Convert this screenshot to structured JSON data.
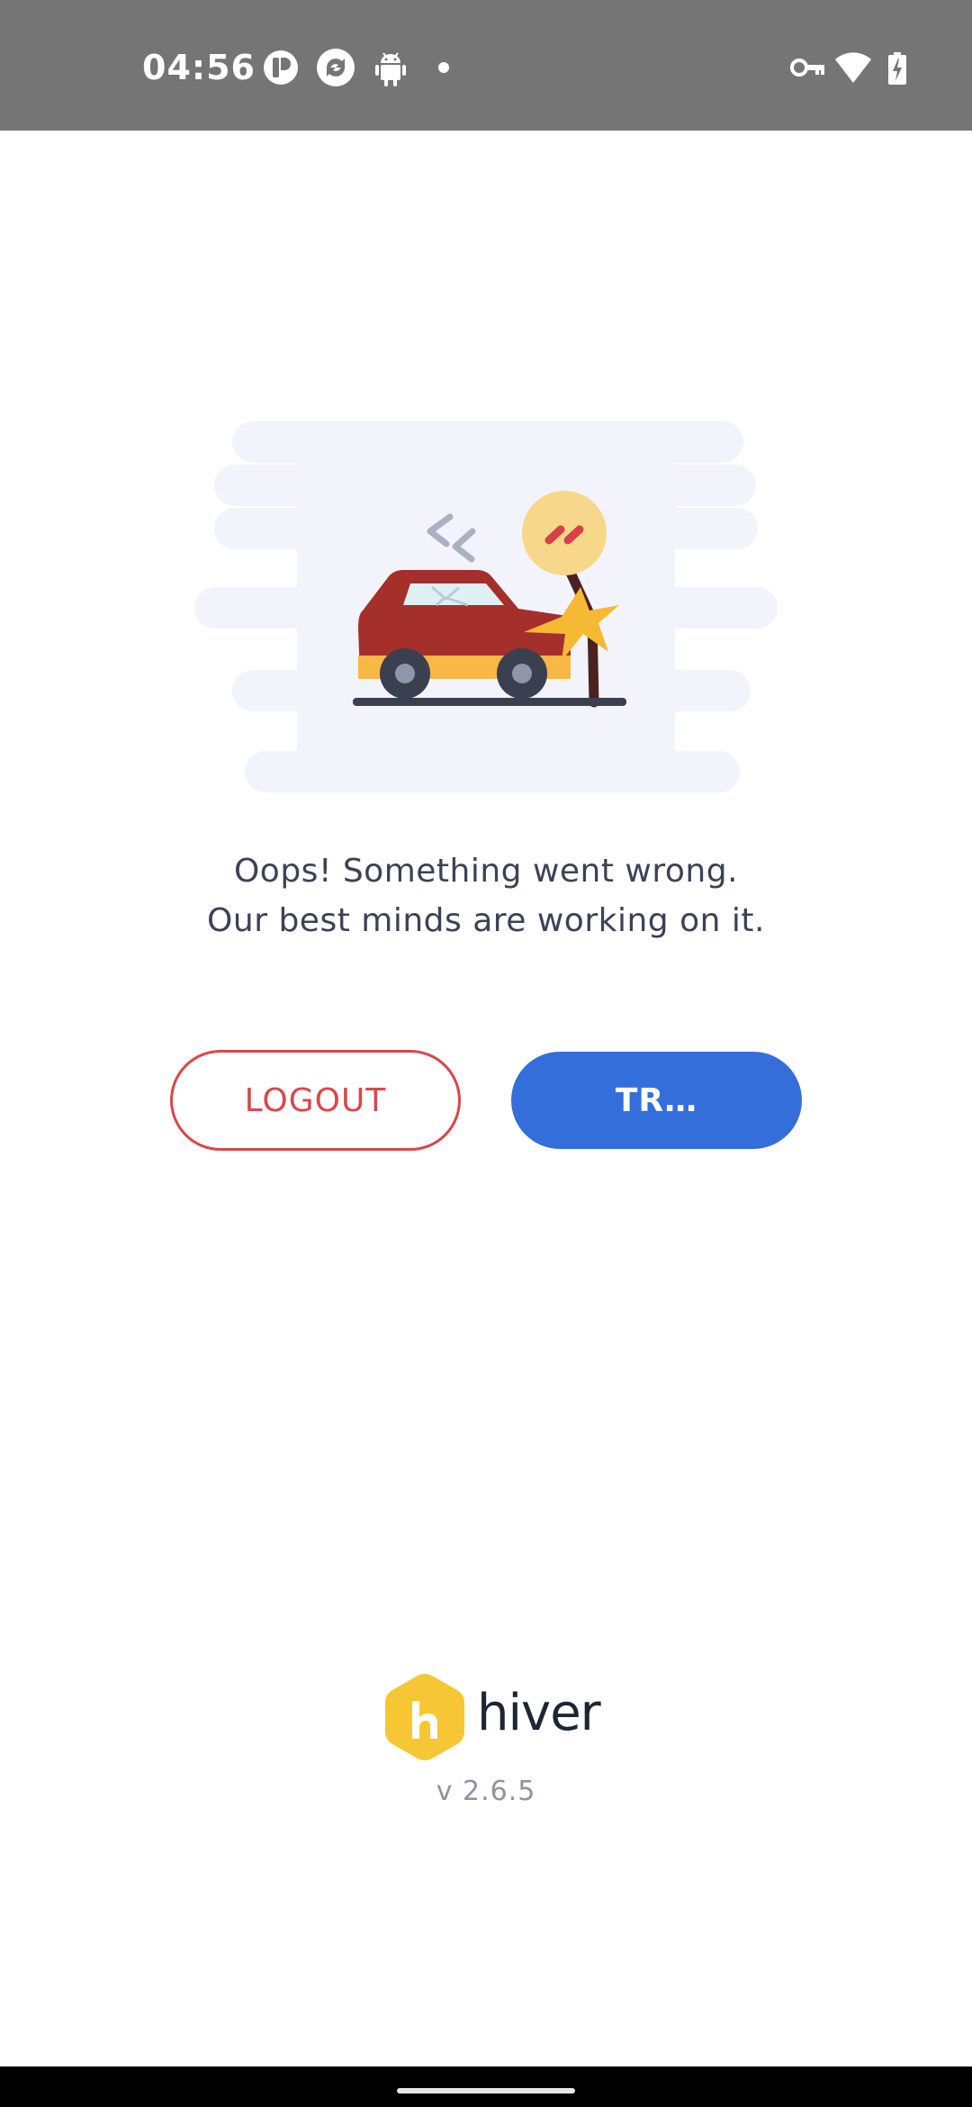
{
  "status_bar": {
    "time": "04:56",
    "left_icons": [
      "outline-app-icon",
      "sync-app-icon",
      "android-icon",
      "notification-dot-icon"
    ],
    "right_icons": [
      "vpn-key-icon",
      "wifi-icon",
      "battery-charging-icon"
    ]
  },
  "error": {
    "illustration": "car-crash-illustration",
    "line1": "Oops! Something went wrong.",
    "line2": "Our best minds are working on it."
  },
  "buttons": {
    "logout_label": "LOGOUT",
    "try_label": "TR…"
  },
  "brand": {
    "logo": "hiver-logo-icon",
    "name": "hiver",
    "version": "v 2.6.5"
  },
  "colors": {
    "status_bar": "#757575",
    "logout": "#d9474b",
    "primary": "#346edb",
    "text": "#3c4256",
    "muted": "#8b93a3",
    "logo_yellow": "#f7c634"
  }
}
